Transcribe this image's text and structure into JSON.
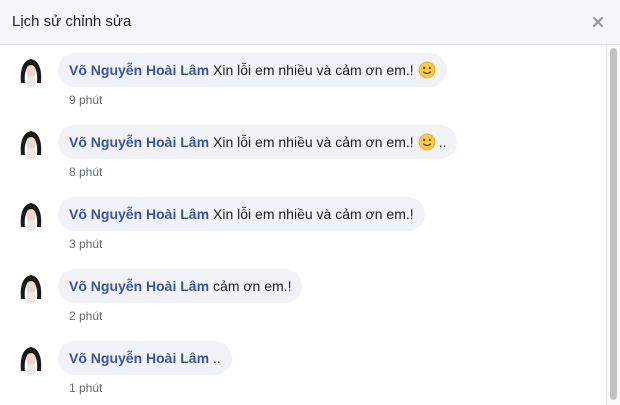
{
  "dialog": {
    "title": "Lịch sử chỉnh sửa"
  },
  "entries": [
    {
      "author": "Võ Nguyễn Hoài Lâm",
      "text": "Xin lỗi em nhiều và cảm ơn em.!",
      "suffix": "",
      "time": "9 phút",
      "emoji": "slightly-smiling-face"
    },
    {
      "author": "Võ Nguyễn Hoài Lâm",
      "text": "Xin lỗi em nhiều và cảm ơn em.!",
      "suffix": "..",
      "time": "8 phút",
      "emoji": "slightly-smiling-face"
    },
    {
      "author": "Võ Nguyễn Hoài Lâm",
      "text": "Xin lỗi em nhiều và cảm ơn em.!",
      "suffix": "",
      "time": "3 phút",
      "emoji": ""
    },
    {
      "author": "Võ Nguyễn Hoài Lâm",
      "text": "cảm ơn em.!",
      "suffix": "",
      "time": "2 phút",
      "emoji": ""
    },
    {
      "author": "Võ Nguyễn Hoài Lâm",
      "text": "..",
      "suffix": "",
      "time": "1 phút",
      "emoji": ""
    }
  ],
  "colors": {
    "author": "#385898",
    "bubble": "#f0f2f5",
    "header": "#f5f6f7",
    "time": "#606770"
  }
}
